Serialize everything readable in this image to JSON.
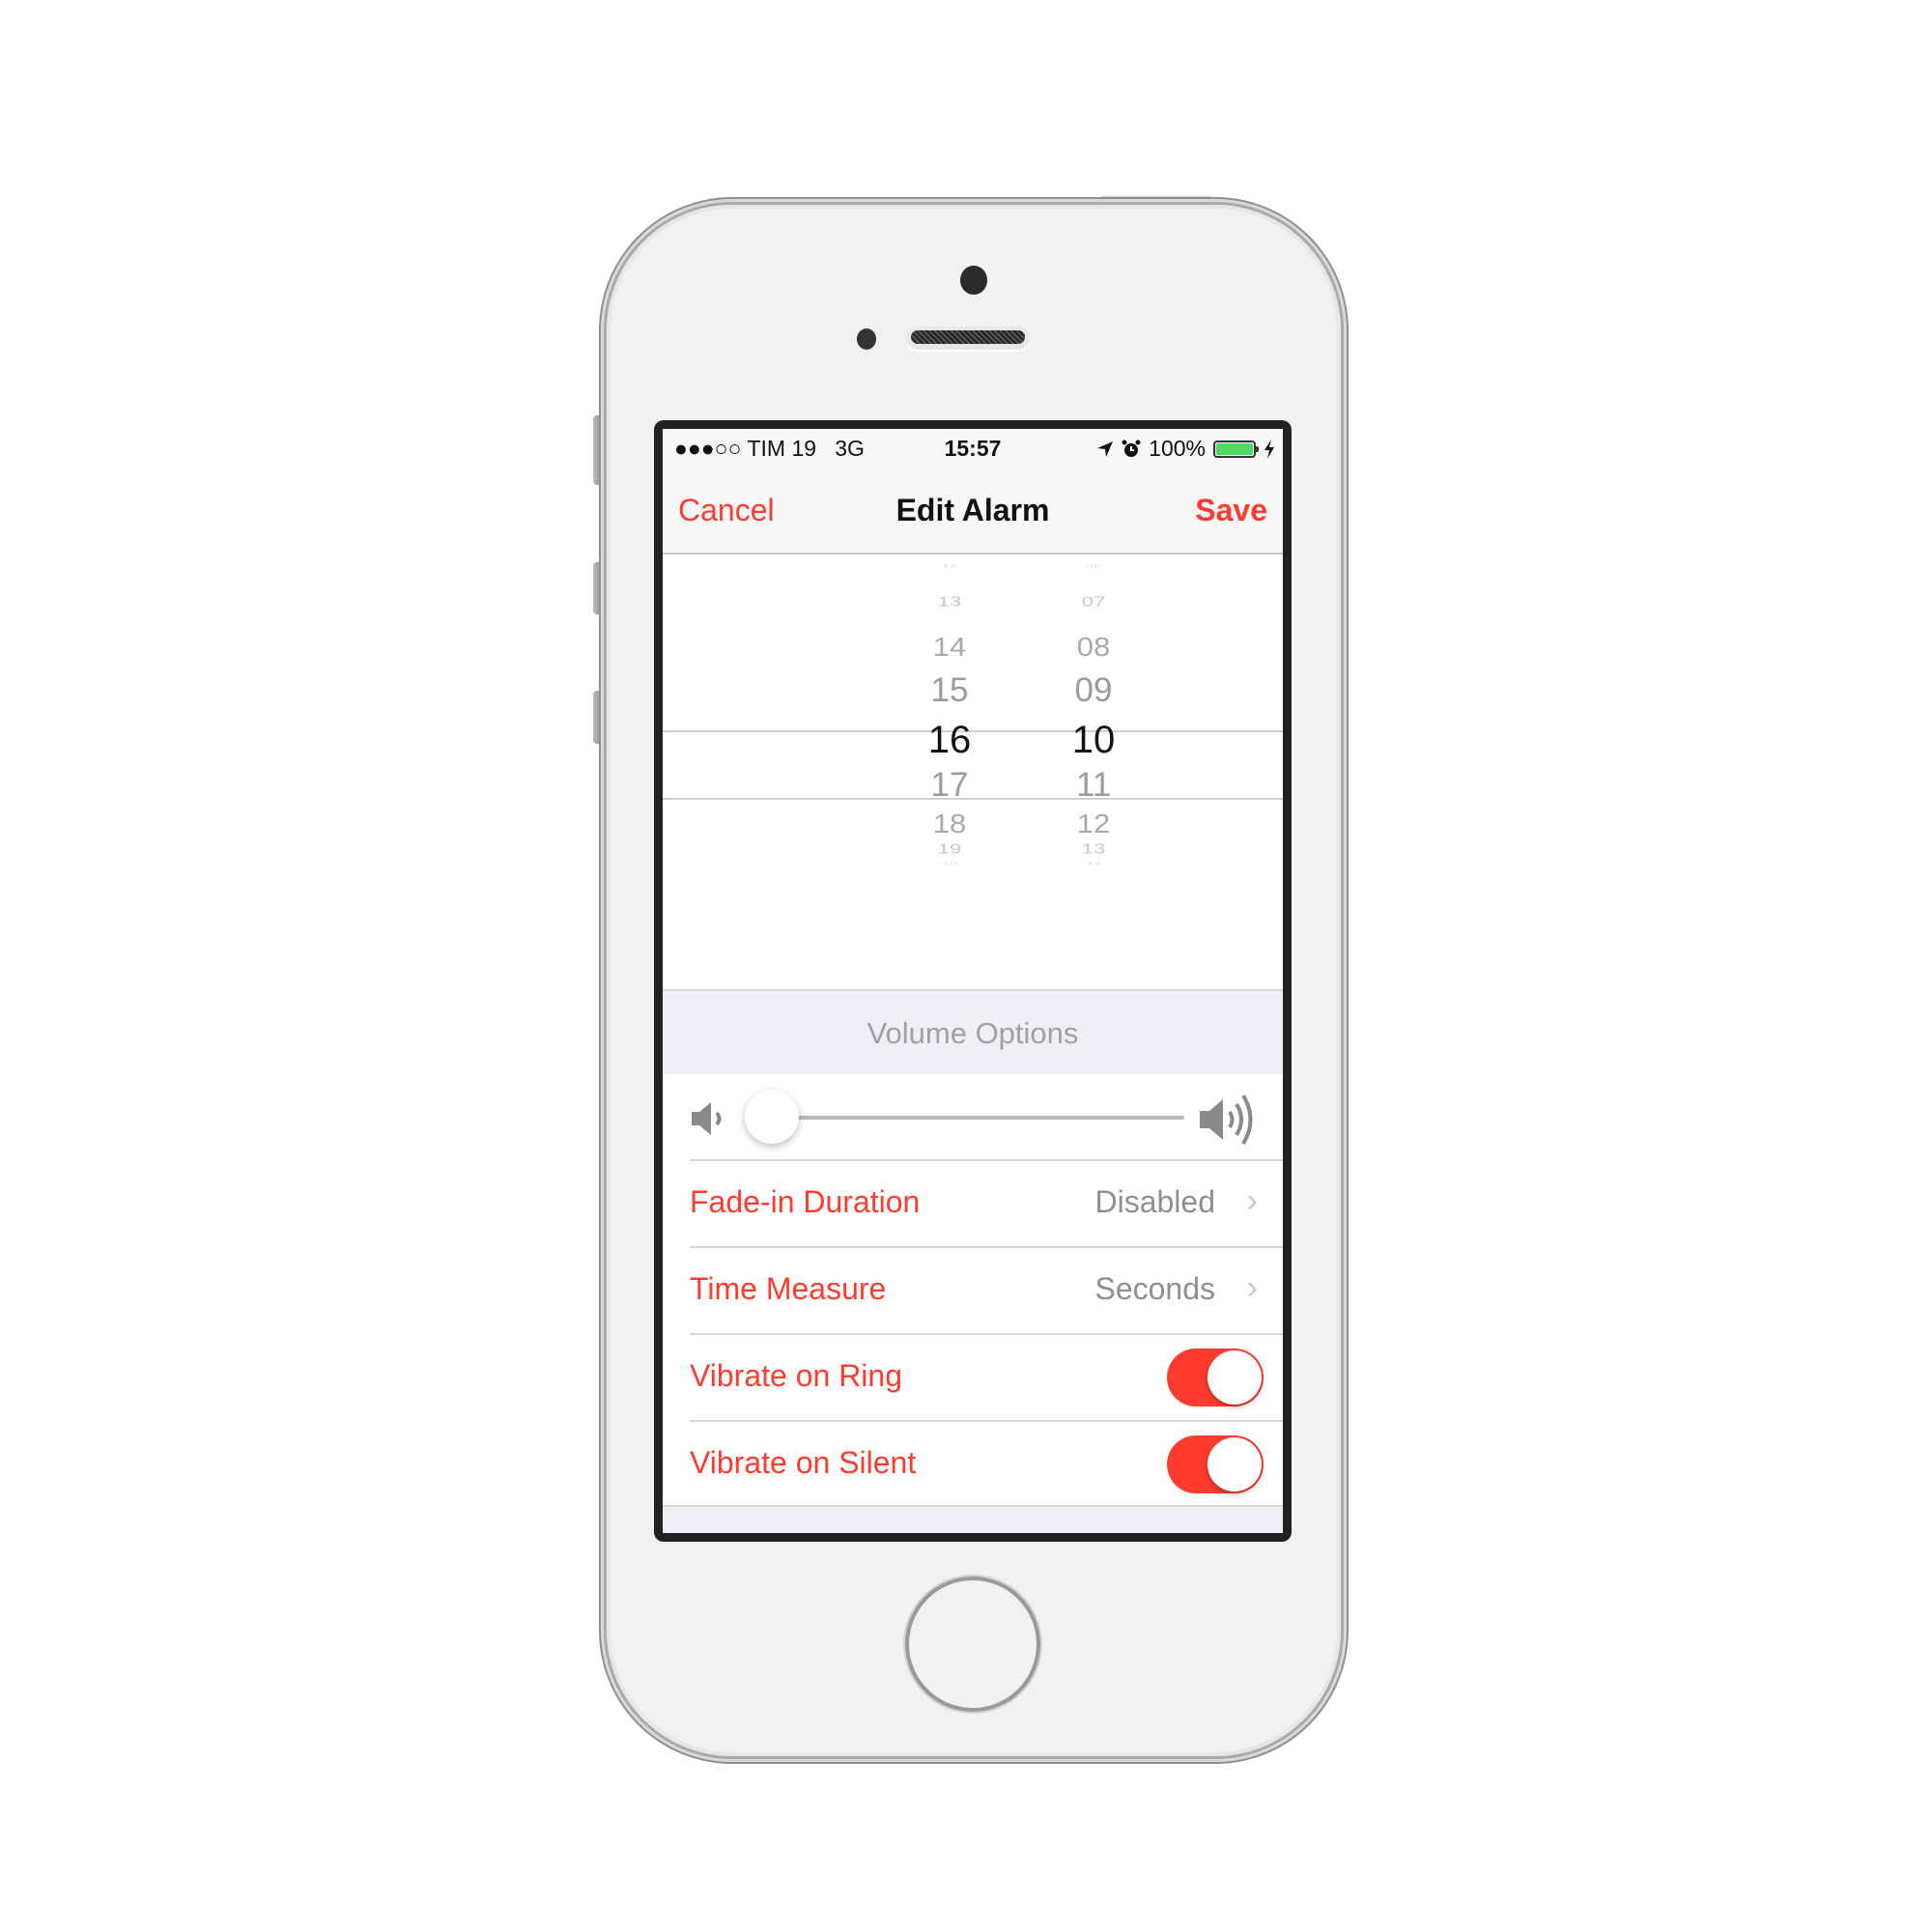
{
  "status_bar": {
    "signal": "●●●○○",
    "carrier": "TIM 19",
    "network": "3G",
    "time": "15:57",
    "battery_percent": "100%",
    "battery_level": 1.0,
    "battery_color": "#4cd964"
  },
  "nav": {
    "cancel_label": "Cancel",
    "title": "Edit Alarm",
    "save_label": "Save"
  },
  "picker": {
    "hours": [
      "12",
      "13",
      "14",
      "15",
      "16",
      "17",
      "18",
      "19",
      "20"
    ],
    "minutes": [
      "06",
      "07",
      "08",
      "09",
      "10",
      "11",
      "12",
      "13",
      "14"
    ],
    "selected_hour": "16",
    "selected_minute": "10"
  },
  "volume_section": {
    "header": "Volume Options",
    "volume_level": 0.0
  },
  "rows": [
    {
      "label": "Fade-in Duration",
      "value": "Disabled",
      "type": "disclosure"
    },
    {
      "label": "Time Measure",
      "value": "Seconds",
      "type": "disclosure"
    },
    {
      "label": "Vibrate on Ring",
      "on": true,
      "type": "toggle"
    },
    {
      "label": "Vibrate on Silent",
      "on": true,
      "type": "toggle"
    }
  ],
  "colors": {
    "accent": "#ff3b30",
    "secondary_text": "#8e8e93",
    "header_text": "#a0a0a5"
  },
  "chevron": "›"
}
